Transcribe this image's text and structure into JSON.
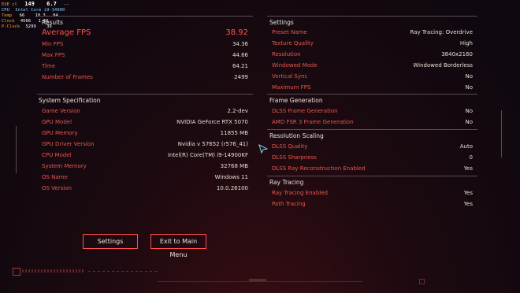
{
  "overlay": {
    "lines": [
      {
        "label": "EXE cl",
        "value": "149",
        "extra": "6.7",
        "extra2": "--"
      },
      {
        "label": "CPU",
        "value": "Intel Core i9-14900"
      },
      {
        "label": "Temp",
        "value": "66",
        "extra": "10.3",
        "extra2": "84"
      },
      {
        "label": "Clock",
        "value": "4566",
        "extra": "1 66"
      },
      {
        "label": "P-Clock",
        "value": "5299",
        "extra": "39"
      }
    ]
  },
  "results": {
    "title": "Results",
    "big": {
      "label": "Average FPS",
      "value": "38.92"
    },
    "rows": [
      {
        "label": "Min FPS",
        "value": "34.36"
      },
      {
        "label": "Max FPS",
        "value": "44.66"
      },
      {
        "label": "Time",
        "value": "64.21"
      },
      {
        "label": "Number of Frames",
        "value": "2499"
      }
    ]
  },
  "system": {
    "title": "System Specification",
    "rows": [
      {
        "label": "Game Version",
        "value": "2.2-dev"
      },
      {
        "label": "GPU Model",
        "value": "NVIDIA GeForce RTX 5070"
      },
      {
        "label": "GPU Memory",
        "value": "11855 MB"
      },
      {
        "label": "GPU Driver Version",
        "value": "Nvidia v 57652 (r576_41)"
      },
      {
        "label": "CPU Model",
        "value": "Intel(R) Core(TM) i9-14900KF"
      },
      {
        "label": "System Memory",
        "value": "32768 MB"
      },
      {
        "label": "OS Name",
        "value": "Windows 11"
      },
      {
        "label": "OS Version",
        "value": "10.0.26100"
      }
    ]
  },
  "settings": {
    "title": "Settings",
    "rows": [
      {
        "label": "Preset Name",
        "value": "Ray Tracing: Overdrive"
      },
      {
        "label": "Texture Quality",
        "value": "High"
      },
      {
        "label": "Resolution",
        "value": "3840x2160"
      },
      {
        "label": "Windowed Mode",
        "value": "Windowed Borderless"
      },
      {
        "label": "Vertical Sync",
        "value": "No"
      },
      {
        "label": "Maximum FPS",
        "value": "No"
      }
    ]
  },
  "framegen": {
    "title": "Frame Generation",
    "rows": [
      {
        "label": "DLSS Frame Generation",
        "value": "No"
      },
      {
        "label": "AMD FSR 3 Frame Generation",
        "value": "No"
      }
    ]
  },
  "scaling": {
    "title": "Resolution Scaling",
    "rows": [
      {
        "label": "DLSS Quality",
        "value": "Auto"
      },
      {
        "label": "DLSS Sharpness",
        "value": "0"
      },
      {
        "label": "DLSS Ray Reconstruction Enabled",
        "value": "Yes"
      }
    ]
  },
  "raytracing": {
    "title": "Ray Tracing",
    "rows": [
      {
        "label": "Ray Tracing Enabled",
        "value": "Yes"
      },
      {
        "label": "Path Tracing",
        "value": "Yes"
      }
    ]
  },
  "buttons": {
    "settings": "Settings",
    "exit": "Exit to Main Menu"
  },
  "colors": {
    "accent": "#ff4d4d",
    "label": "#e8584c",
    "value": "#e4e0d2",
    "overlay_label": "#ff9a2e",
    "overlay_value": "#ffffff",
    "overlay_cpu": "#7fd4ff"
  }
}
